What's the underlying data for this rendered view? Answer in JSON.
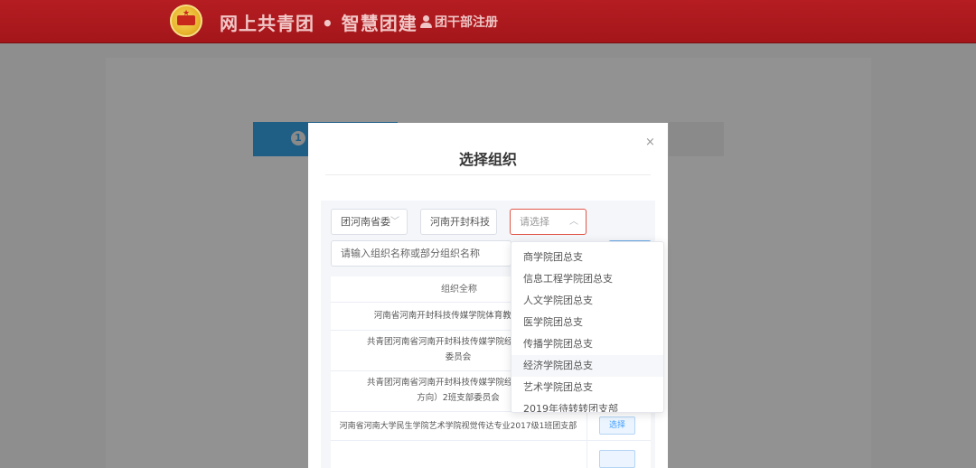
{
  "header": {
    "title": "网上共青团 • 智慧团建",
    "register_label": "团干部注册",
    "bg_color": "#a8191d"
  },
  "background": {
    "step_number": "1"
  },
  "modal": {
    "title": "选择组织",
    "close": "×",
    "selects": [
      {
        "value": "团河南省委"
      },
      {
        "value": "河南开封科技"
      },
      {
        "value": "请选择"
      }
    ],
    "search_placeholder": "请输入组织名称或部分组织名称",
    "table": {
      "header": "组织全称",
      "rows": [
        {
          "name": "河南省河南开封科技传媒学院体育教育专业2",
          "action": ""
        },
        {
          "name": "共青团河南省河南开封科技传媒学院经济学院20",
          "name2": "委员会",
          "action": ""
        },
        {
          "name": "共青团河南省河南开封科技传媒学院经济学院20",
          "name2": "方向）2班支部委员会",
          "action": ""
        },
        {
          "name": "河南省河南大学民生学院艺术学院视觉传达专业2017级1班团支部",
          "action": "选择"
        }
      ]
    }
  },
  "dropdown": {
    "options": [
      "商学院团总支",
      "信息工程学院团总支",
      "人文学院团总支",
      "医学院团总支",
      "传播学院团总支",
      "经济学院团总支",
      "艺术学院团总支",
      "2019年待转转团支部"
    ],
    "hovered_index": 5
  }
}
